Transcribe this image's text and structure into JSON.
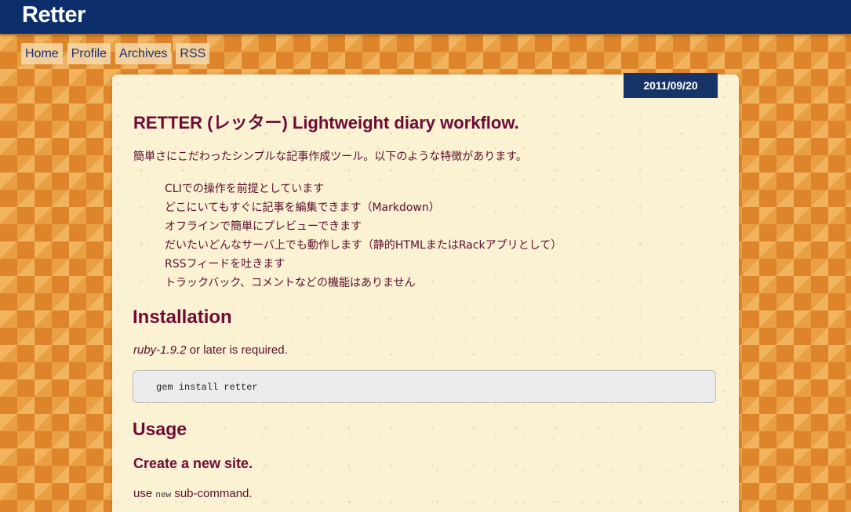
{
  "site": {
    "title": "Retter"
  },
  "nav": {
    "items": [
      {
        "label": "Home"
      },
      {
        "label": "Profile"
      },
      {
        "label": "Archives"
      },
      {
        "label": "RSS"
      }
    ]
  },
  "entry": {
    "date": "2011/09/20",
    "title": "RETTER (レッター) Lightweight diary workflow.",
    "intro": "簡単さにこだわったシンプルな記事作成ツール。以下のような特徴があります。",
    "features": [
      "CLIでの操作を前提としています",
      "どこにいてもすぐに記事を編集できます（Markdown）",
      "オフラインで簡単にプレビューできます",
      "だいたいどんなサーバ上でも動作します（静的HTMLまたはRackアプリとして）",
      "RSSフィードを吐きます",
      "トラックバック、コメントなどの機能はありません"
    ],
    "installation": {
      "heading": "Installation",
      "requirement_em": "ruby-1.9.2",
      "requirement_rest": " or later is required.",
      "code": "gem install retter"
    },
    "usage": {
      "heading": "Usage",
      "subheading": "Create a new site.",
      "line_prefix": "use ",
      "line_code": "new",
      "line_suffix": " sub-command."
    }
  },
  "colors": {
    "topbar": "#0c2f6b",
    "heading": "#6e0b35",
    "paper": "#fbf1d3",
    "background": "#e9a044",
    "date_badge": "#173468"
  }
}
